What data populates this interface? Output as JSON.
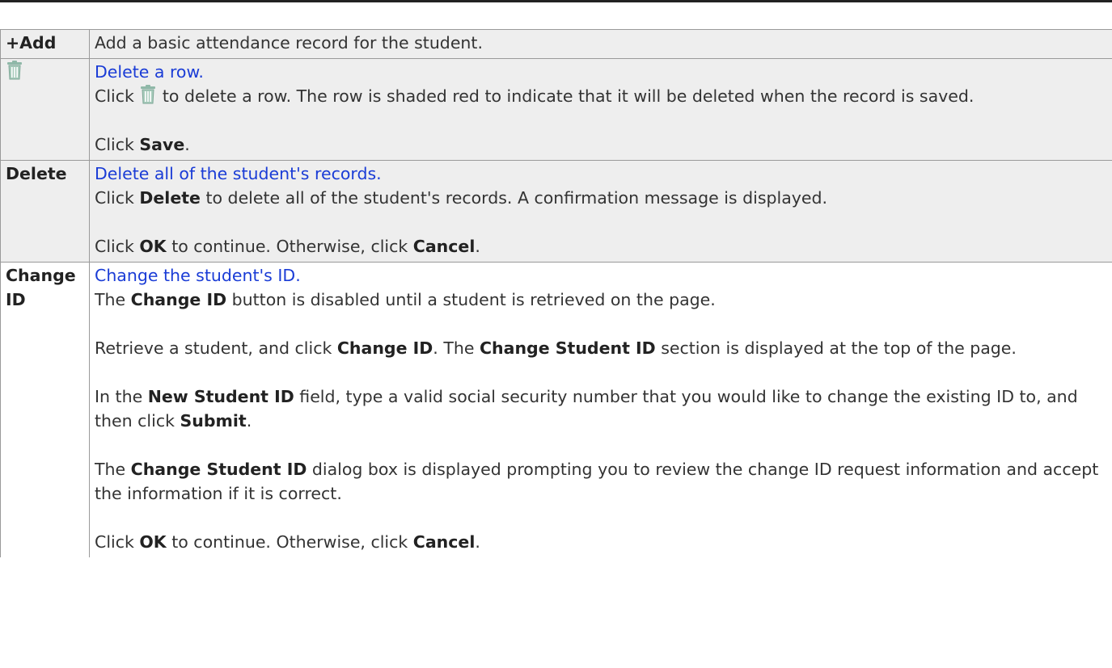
{
  "rows": [
    {
      "key": "+Add",
      "desc": "Add a basic attendance record for the student."
    },
    {
      "icon": "trash-icon",
      "link": "Delete a row.",
      "p1_pre": "Click ",
      "p1_post": " to delete a row. The row is shaded red to indicate that it will be deleted when the record is saved.",
      "p2_pre": "Click ",
      "p2_bold": "Save",
      "p2_post": "."
    },
    {
      "key": "Delete",
      "link": "Delete all of the student's records.",
      "p1_pre": "Click ",
      "p1_bold": "Delete",
      "p1_post": " to delete all of the student's records. A confirmation message is displayed.",
      "p2_pre": "Click ",
      "p2_bold1": "OK",
      "p2_mid": " to continue. Otherwise, click ",
      "p2_bold2": "Cancel",
      "p2_post": "."
    },
    {
      "key_line1": "Change",
      "key_line2": "ID",
      "link": "Change the student's ID.",
      "p1_pre": "The ",
      "p1_bold": "Change ID",
      "p1_post": " button is disabled until a student is retrieved on the page.",
      "p2_pre": "Retrieve a student, and click ",
      "p2_bold1": "Change ID",
      "p2_mid": ". The ",
      "p2_bold2": "Change Student ID",
      "p2_post": " section is displayed at the top of the page.",
      "p3_pre": "In the ",
      "p3_bold1": "New Student ID",
      "p3_mid": " field, type a valid social security number that you would like to change the existing ID to, and then click ",
      "p3_bold2": "Submit",
      "p3_post": ".",
      "p4_pre": "The ",
      "p4_bold": "Change Student ID",
      "p4_post": " dialog box is displayed prompting you to review the change ID request information and accept the information if it is correct.",
      "p5_pre": "Click ",
      "p5_bold1": "OK",
      "p5_mid": " to continue. Otherwise, click ",
      "p5_bold2": "Cancel",
      "p5_post": "."
    }
  ],
  "colors": {
    "link": "#1a3cd6",
    "shaded_row": "#eeeeee",
    "border": "#9a9a9a",
    "trash_icon": "#8fb8a8"
  }
}
